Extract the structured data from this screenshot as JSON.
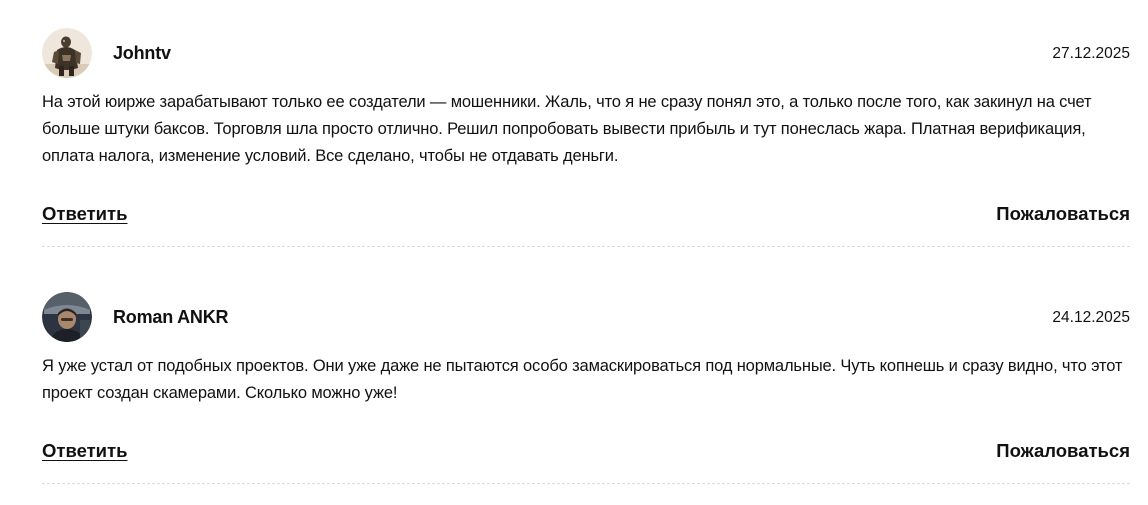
{
  "comments": [
    {
      "author": "Johntv",
      "date": "27.12.2025",
      "avatar_icon": "user-avatar-photo",
      "text": "На этой юирже зарабатывают только ее создатели — мошенники. Жаль, что я не сразу понял это, а только после того, как закинул на счет больше штуки баксов. Торговля шла просто отлично. Решил попробовать вывести прибыль и тут понеслась жара. Платная верификация, оплата налога, изменение условий. Все сделано, чтобы не отдавать деньги.",
      "reply_label": "Ответить",
      "report_label": "Пожаловаться"
    },
    {
      "author": "Roman ANKR",
      "date": "24.12.2025",
      "avatar_icon": "user-avatar-photo",
      "text": "Я уже устал от подобных проектов. Они уже даже не пытаются особо замаскироваться под нормальные. Чуть копнешь и сразу видно, что этот проект создан скамерами. Сколько можно уже!",
      "reply_label": "Ответить",
      "report_label": "Пожаловаться"
    }
  ]
}
